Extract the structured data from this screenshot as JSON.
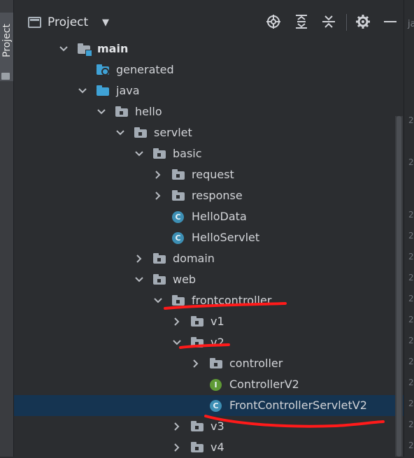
{
  "sidebar": {
    "tab_label": "Project"
  },
  "header": {
    "title": "Project",
    "dropdown_icon": "caret-down-icon",
    "tools": [
      "locate-icon",
      "expand-all-icon",
      "collapse-all-icon",
      "gear-icon",
      "minimize-icon"
    ]
  },
  "tree": [
    {
      "label": "main",
      "depth": 0,
      "icon": "module-folder",
      "arrow": "down",
      "bold": true
    },
    {
      "label": "generated",
      "depth": 1,
      "icon": "generated-folder",
      "arrow": "none"
    },
    {
      "label": "java",
      "depth": 1,
      "icon": "source-folder",
      "arrow": "down"
    },
    {
      "label": "hello",
      "depth": 2,
      "icon": "package",
      "arrow": "down"
    },
    {
      "label": "servlet",
      "depth": 3,
      "icon": "package",
      "arrow": "down"
    },
    {
      "label": "basic",
      "depth": 4,
      "icon": "package",
      "arrow": "down"
    },
    {
      "label": "request",
      "depth": 5,
      "icon": "package",
      "arrow": "right"
    },
    {
      "label": "response",
      "depth": 5,
      "icon": "package",
      "arrow": "right"
    },
    {
      "label": "HelloData",
      "depth": 5,
      "icon": "class",
      "arrow": "none"
    },
    {
      "label": "HelloServlet",
      "depth": 5,
      "icon": "class",
      "arrow": "none"
    },
    {
      "label": "domain",
      "depth": 4,
      "icon": "package",
      "arrow": "right"
    },
    {
      "label": "web",
      "depth": 4,
      "icon": "package",
      "arrow": "down"
    },
    {
      "label": "frontcontroller",
      "depth": 5,
      "icon": "package",
      "arrow": "down"
    },
    {
      "label": "v1",
      "depth": 6,
      "icon": "package",
      "arrow": "right"
    },
    {
      "label": "v2",
      "depth": 6,
      "icon": "package",
      "arrow": "down"
    },
    {
      "label": "controller",
      "depth": 7,
      "icon": "package",
      "arrow": "right"
    },
    {
      "label": "ControllerV2",
      "depth": 7,
      "icon": "interface",
      "arrow": "none"
    },
    {
      "label": "FrontControllerServletV2",
      "depth": 7,
      "icon": "class",
      "arrow": "none",
      "selected": true
    },
    {
      "label": "v3",
      "depth": 6,
      "icon": "package",
      "arrow": "right"
    },
    {
      "label": "v4",
      "depth": 6,
      "icon": "package",
      "arrow": "right"
    }
  ],
  "gutter": {
    "text": "ja"
  }
}
